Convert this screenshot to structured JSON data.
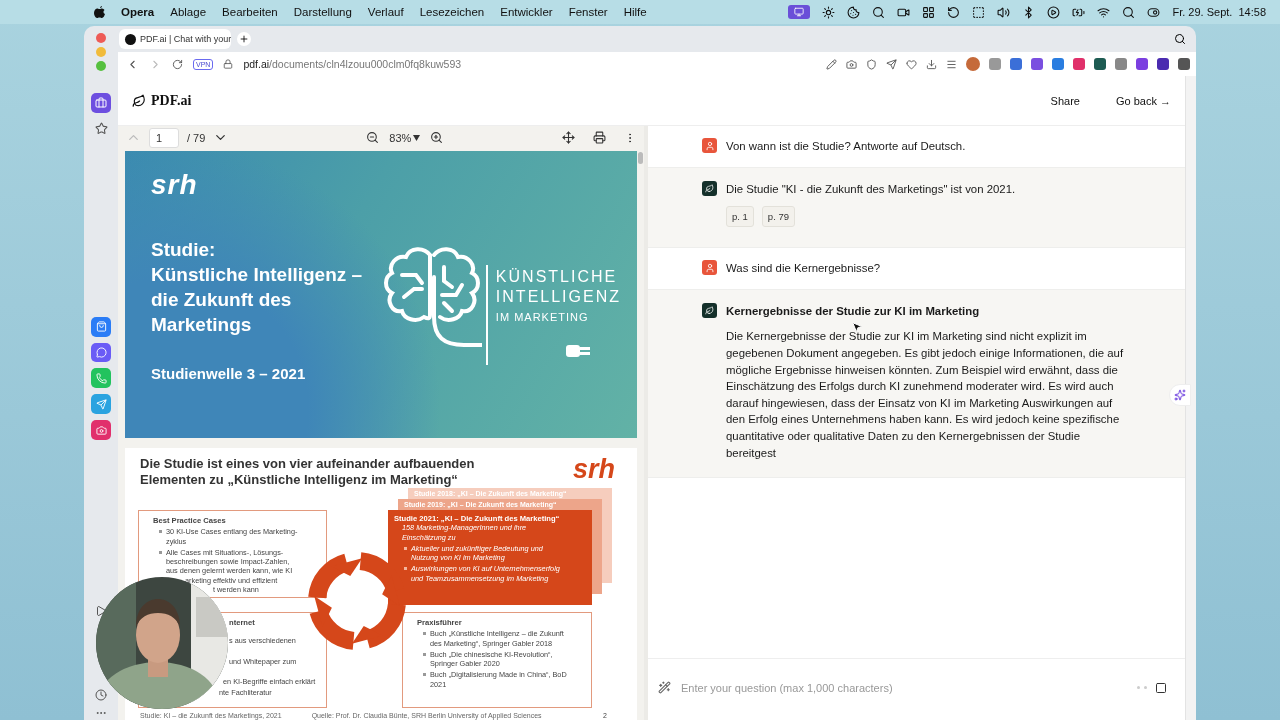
{
  "menu_bar": {
    "app": "Opera",
    "menus": [
      "Ablage",
      "Bearbeiten",
      "Darstellung",
      "Verlauf",
      "Lesezeichen",
      "Entwickler",
      "Fenster",
      "Hilfe"
    ],
    "clock": "Fr. 29. Sept.  14:58"
  },
  "browser": {
    "tab_title": "PDF.ai | Chat with your",
    "vpn": "VPN",
    "url_host": "pdf.ai",
    "url_path": "/documents/cln4lzouu000clm0fq8kuw593"
  },
  "header": {
    "logo": "PDF.ai",
    "share": "Share",
    "go_back": "Go back →"
  },
  "pdf_toolbar": {
    "page": "1",
    "total": "/ 79",
    "zoom": "83%"
  },
  "slide_1": {
    "logo": "srh",
    "title": [
      "Studie:",
      "Künstliche Intelligenz –",
      "die Zukunft des",
      "Marketings"
    ],
    "subtitle": "Studienwelle 3 – 2021",
    "badge": [
      "KÜNSTLICHE",
      "INTELLIGENZ",
      "IM MARKETING"
    ]
  },
  "slide_2": {
    "title": [
      "Die Studie ist eines von vier aufeinander aufbauenden",
      "Elementen zu „Künstliche Intelligenz im Marketing“"
    ],
    "logo": "srh",
    "back_cards": [
      "Studie 2018: „KI – Die Zukunft des Marketing“",
      "Studie 2019: „KI – Die Zukunft des Marketing“"
    ],
    "main_card": {
      "title": "Studie 2021: „KI – Die Zukunft des Marketing“",
      "intro": [
        "158 Marketing-ManagerInnen und ihre",
        "Einschätzung zu"
      ],
      "bullets": [
        [
          "Aktueller und zukünftiger Bedeutung und",
          "Nutzung von KI im Marketing"
        ],
        [
          "Auswirkungen von KI auf Unternehmenserfolg",
          "und Teamzusammensetzung im Marketing"
        ]
      ]
    },
    "best_practice": {
      "title": "Best Practice Cases",
      "bullets": [
        [
          "30 KI-Use Cases entlang des Marketing-",
          "zyklus"
        ],
        [
          "Alle Cases mit Situations-, Lösungs-",
          "beschreibungen sowie Impact-Zahlen,",
          "aus denen gelernt werden kann, wie KI"
        ]
      ],
      "fragments": [
        "arketing effektiv und effizient",
        "t werden kann"
      ]
    },
    "internet": {
      "title": "nternet",
      "fragments": [
        "s aus verschiedenen",
        "und Whitepaper zum",
        "en KI-Begriffe einfach erklärt",
        "nte Fachliteratur"
      ]
    },
    "praxis": {
      "title": "Praxisführer",
      "bullets": [
        [
          "Buch „Künstliche Intelligenz – die Zukunft",
          "des Marketing“, Springer Gabler 2018"
        ],
        [
          "Buch „Die chinesische KI-Revolution“,",
          "Springer Gabler 2020"
        ],
        [
          "Buch „Digitalisierung Made in China“, BoD",
          "2021"
        ]
      ]
    },
    "footer": [
      "Studie: KI – die Zukunft des Marketings, 2021",
      "Quelle: Prof. Dr. Claudia Bünte, SRH Berlin University of Applied Sciences"
    ],
    "page_number": "2"
  },
  "chat": {
    "messages": [
      {
        "kind": "user",
        "text": "Von wann ist die Studie? Antworte auf Deutsch."
      },
      {
        "kind": "assistant",
        "text": "Die Studie \"KI - die Zukunft des Marketings\" ist von 2021.",
        "sources": [
          "p. 1",
          "p. 79"
        ]
      },
      {
        "kind": "user",
        "text": "Was sind die Kernergebnisse?"
      },
      {
        "kind": "assistant",
        "title": "Kernergebnisse der Studie zur KI im Marketing",
        "text": "Die Kernergebnisse der Studie zur KI im Marketing sind nicht explizit im gegebenen Dokument angegeben. Es gibt jedoch einige Informationen, die auf mögliche Ergebnisse hinweisen könnten. Zum Beispiel wird erwähnt, dass die Einschätzung des Erfolgs durch KI zunehmend moderater wird. Es wird auch darauf hingewiesen, dass der Einsatz von KI im Marketing Auswirkungen auf den Erfolg eines Unternehmens haben kann. Es wird jedoch keine spezifische quantitative oder qualitative Daten zu den Kernergebnissen der Studie bereitgest"
      }
    ],
    "placeholder": "Enter your question (max 1,000 characters)"
  }
}
